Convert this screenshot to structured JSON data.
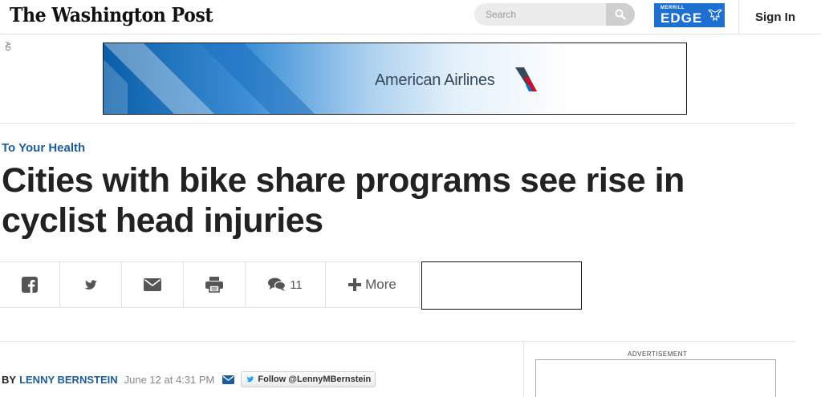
{
  "header": {
    "logo": "The Washington Post",
    "search": {
      "placeholder": "Search"
    },
    "sponsor": {
      "small": "MERRILL",
      "big": "EDGE"
    },
    "sign_in": "Sign In"
  },
  "ad": {
    "label": "AD",
    "banner_text": "American Airlines"
  },
  "article": {
    "kicker": "To Your Health",
    "headline": "Cities with bike share programs see rise in cyclist head injuries"
  },
  "share": {
    "comment_count": "11",
    "more_label": "More",
    "icons": [
      "facebook-icon",
      "twitter-icon",
      "email-icon",
      "print-icon",
      "comments-icon",
      "plus-icon"
    ]
  },
  "byline": {
    "by": "BY",
    "author": "LENNY BERNSTEIN",
    "date": "June 12 at 4:31 PM",
    "follow": "Follow @LennyMBernstein"
  },
  "sidebar": {
    "advertisement_label": "ADVERTISEMENT"
  },
  "colors": {
    "link_blue": "#1a5c9c",
    "edge_blue": "#1d6fd1",
    "twitter_blue": "#1da1f2"
  }
}
